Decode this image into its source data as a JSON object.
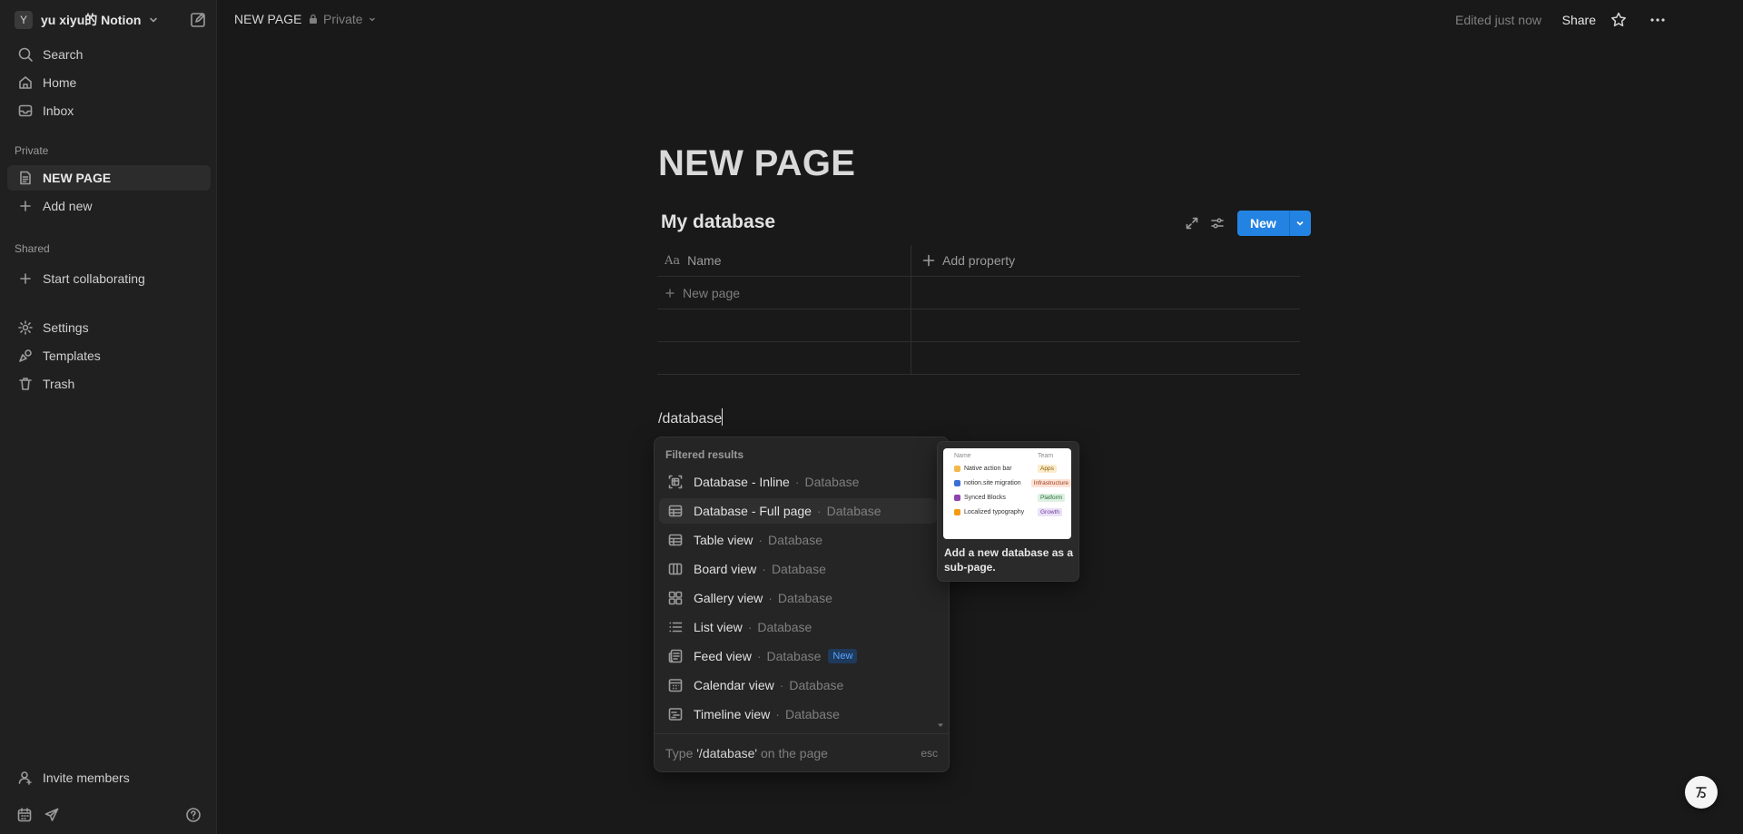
{
  "sidebar": {
    "workspace": {
      "avatar": "Y",
      "name": "yu xiyu的 Notion"
    },
    "nav": [
      {
        "label": "Search",
        "icon": "search-icon"
      },
      {
        "label": "Home",
        "icon": "home-icon"
      },
      {
        "label": "Inbox",
        "icon": "inbox-icon"
      }
    ],
    "private_label": "Private",
    "private_items": [
      {
        "label": "NEW PAGE",
        "icon": "page-icon"
      },
      {
        "label": "Add new",
        "icon": "plus-icon"
      }
    ],
    "shared_label": "Shared",
    "shared_items": [
      {
        "label": "Start collaborating",
        "icon": "plus-icon"
      }
    ],
    "settings_items": [
      {
        "label": "Settings",
        "icon": "gear-icon"
      },
      {
        "label": "Templates",
        "icon": "templates-icon"
      },
      {
        "label": "Trash",
        "icon": "trash-icon"
      }
    ],
    "invite_label": "Invite members"
  },
  "topbar": {
    "breadcrumb": "NEW PAGE",
    "privacy": "Private",
    "edited": "Edited just now",
    "share": "Share"
  },
  "page": {
    "title": "NEW PAGE",
    "database": {
      "title": "My database",
      "new_button": "New",
      "column_name": "Name",
      "add_property": "Add property",
      "new_page": "New page"
    },
    "slash_command": "/database"
  },
  "menu": {
    "header": "Filtered results",
    "items": [
      {
        "name": "Database - Inline",
        "category": "Database",
        "icon": "database-inline-icon",
        "highlighted": false
      },
      {
        "name": "Database - Full page",
        "category": "Database",
        "icon": "table-icon",
        "highlighted": true
      },
      {
        "name": "Table view",
        "category": "Database",
        "icon": "table-icon",
        "highlighted": false
      },
      {
        "name": "Board view",
        "category": "Database",
        "icon": "board-icon",
        "highlighted": false
      },
      {
        "name": "Gallery view",
        "category": "Database",
        "icon": "gallery-icon",
        "highlighted": false
      },
      {
        "name": "List view",
        "category": "Database",
        "icon": "list-icon",
        "highlighted": false
      },
      {
        "name": "Feed view",
        "category": "Database",
        "icon": "feed-icon",
        "badge": "New",
        "highlighted": false
      },
      {
        "name": "Calendar view",
        "category": "Database",
        "icon": "calendar-icon",
        "highlighted": false
      },
      {
        "name": "Timeline view",
        "category": "Database",
        "icon": "timeline-icon",
        "highlighted": false
      }
    ],
    "footer": {
      "prefix": "Type",
      "command": "'/database'",
      "suffix": "on the page",
      "esc": "esc"
    }
  },
  "preview": {
    "header": {
      "name": "Name",
      "team": "Team"
    },
    "rows": [
      {
        "name": "Native action bar",
        "tag": "Apps",
        "dot": "#f2b84b",
        "tag_bg": "#fbeccc",
        "tag_fg": "#8a5a00"
      },
      {
        "name": "notion.site migration",
        "tag": "Infrastructure",
        "dot": "#3b6fd4",
        "tag_bg": "#fde2d6",
        "tag_fg": "#9a3d1a"
      },
      {
        "name": "Synced Blocks",
        "tag": "Platform",
        "dot": "#8e44ad",
        "tag_bg": "#dcf1e1",
        "tag_fg": "#2b6b3a"
      },
      {
        "name": "Localized typography",
        "tag": "Growth",
        "dot": "#f39c12",
        "tag_bg": "#ece1f7",
        "tag_fg": "#6b3fa0"
      }
    ],
    "caption": "Add a new database as a sub-page."
  },
  "colors": {
    "accent": "#2383e2",
    "background": "#191919",
    "sidebar": "#202020"
  }
}
